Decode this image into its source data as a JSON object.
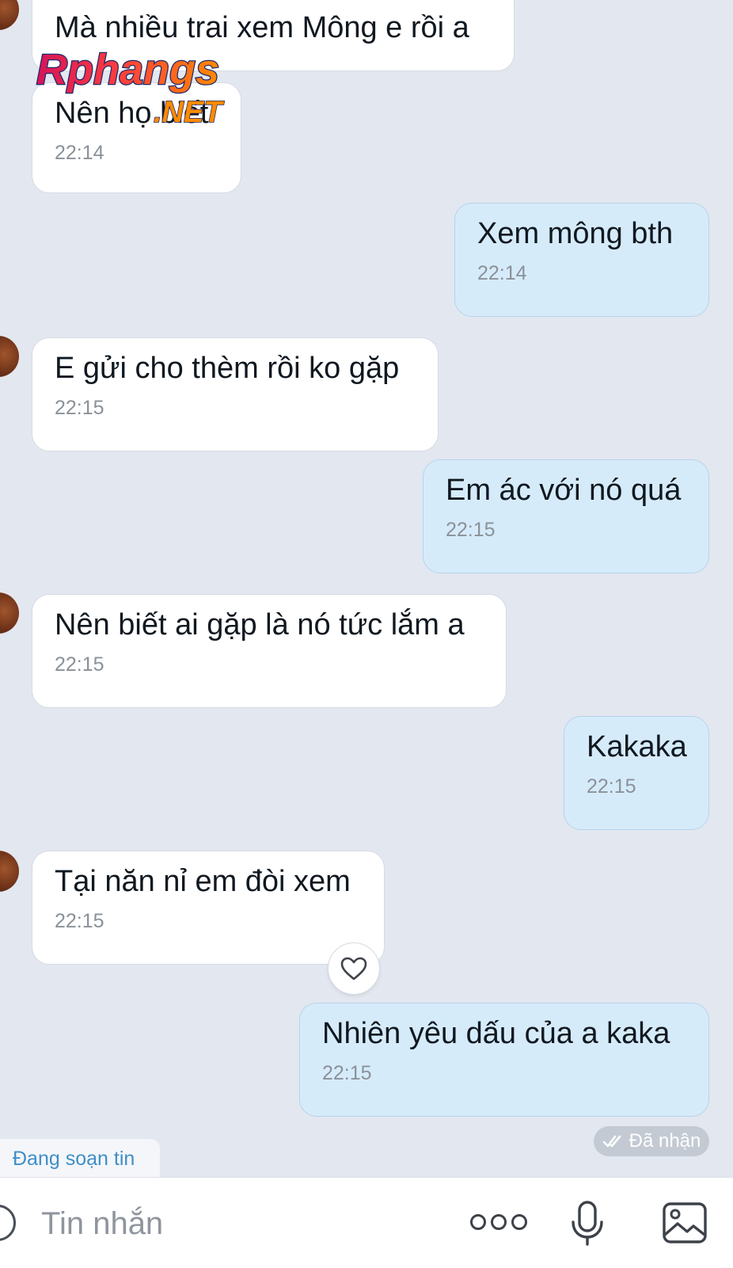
{
  "messages": [
    {
      "side": "in",
      "text": "Mà nhiều trai xem Mông e rồi a",
      "time": ""
    },
    {
      "side": "in",
      "text": "Nên họ biết",
      "time": "22:14"
    },
    {
      "side": "out",
      "text": "Xem mông bth",
      "time": "22:14"
    },
    {
      "side": "in",
      "text": "E gửi cho thèm rồi ko gặp",
      "time": "22:15"
    },
    {
      "side": "out",
      "text": "Em ác với nó quá",
      "time": "22:15"
    },
    {
      "side": "in",
      "text": "Nên biết ai gặp là nó tức lắm a",
      "time": "22:15"
    },
    {
      "side": "out",
      "text": "Kakaka",
      "time": "22:15"
    },
    {
      "side": "in",
      "text": "Tại năn nỉ em đòi xem",
      "time": "22:15"
    },
    {
      "side": "out",
      "text": "Nhiên yêu dấu của a kaka",
      "time": "22:15"
    }
  ],
  "status": {
    "received_label": "Đã nhận"
  },
  "typing_indicator": "Đang soạn tin",
  "composer": {
    "placeholder": "Tin nhắn"
  },
  "watermark": {
    "text1": "Rphangs",
    "text2": ".NET"
  },
  "colors": {
    "background": "#e3e7ef",
    "incoming_bubble": "#ffffff",
    "outgoing_bubble": "#d6ebfa",
    "typing_text": "#3f8ec7"
  },
  "icons": [
    "heart-icon",
    "double-check-icon",
    "emoji-icon",
    "more-icon",
    "mic-icon",
    "gallery-icon"
  ]
}
